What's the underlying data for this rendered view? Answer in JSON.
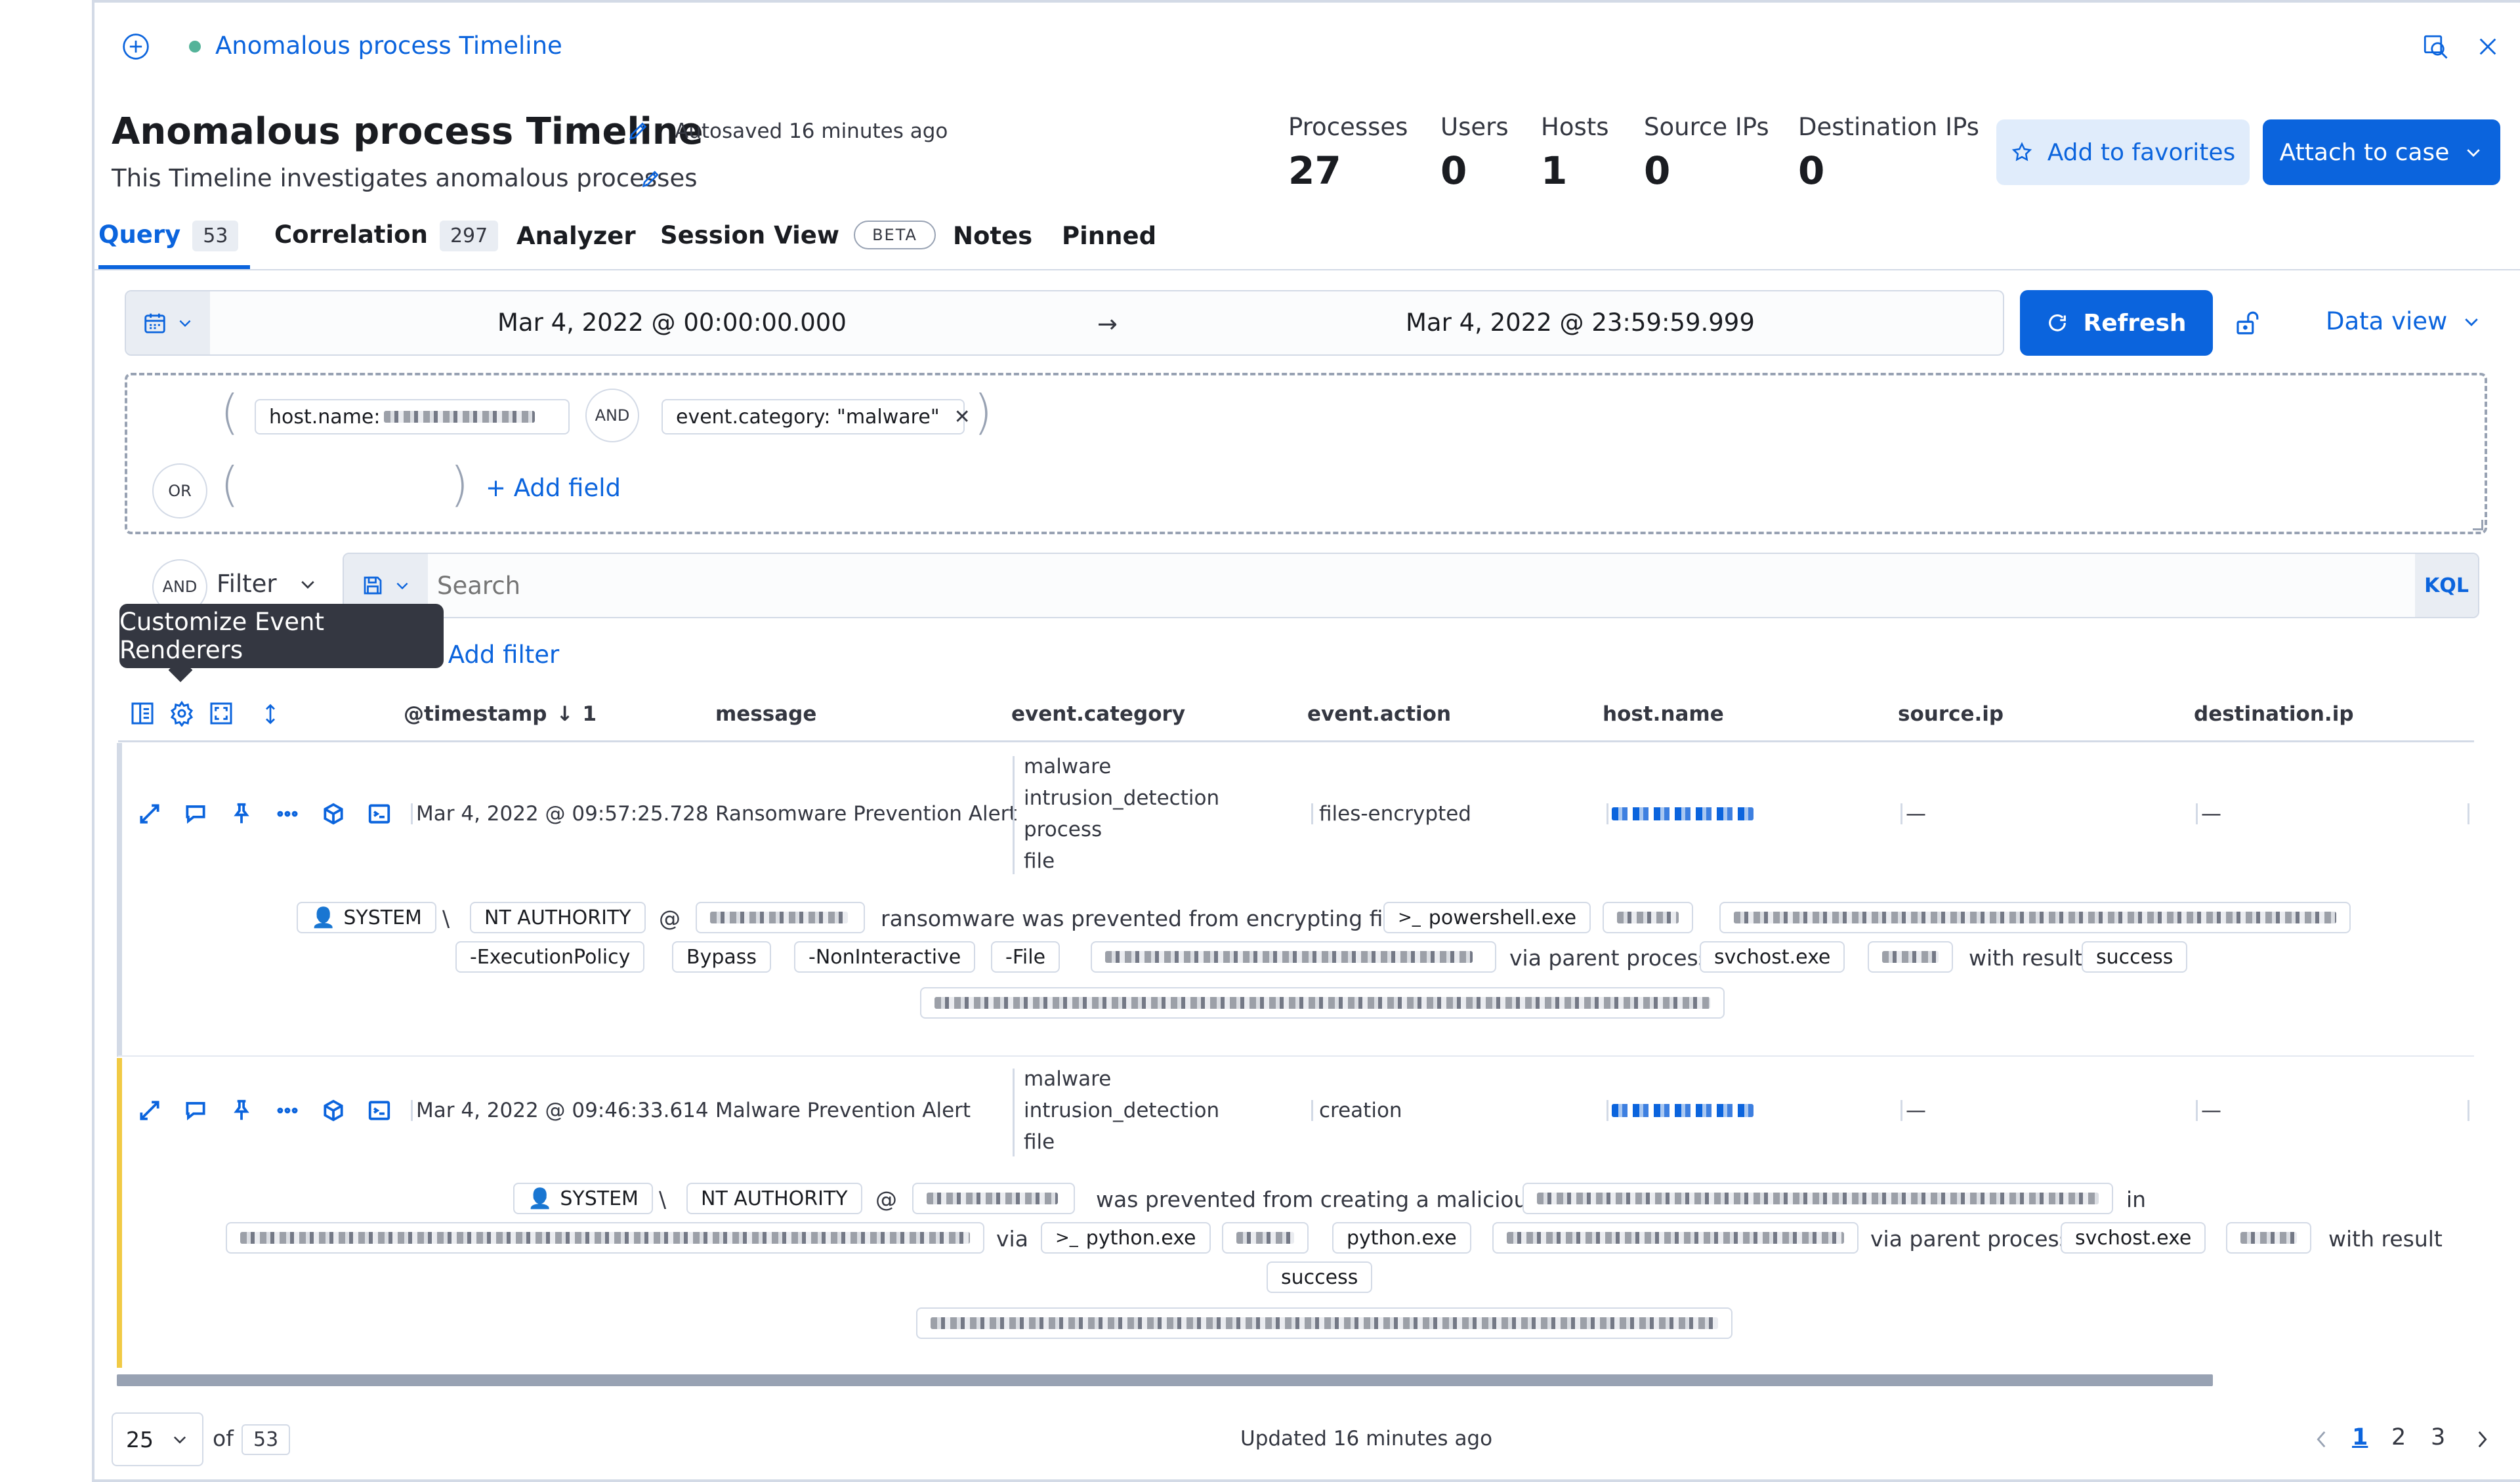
{
  "header": {
    "breadcrumb_title": "Anomalous process Timeline",
    "title": "Anomalous process Timeline",
    "autosaved": "Autosaved 16 minutes ago",
    "description": "This Timeline investigates anomalous processes"
  },
  "stats": [
    {
      "label": "Processes",
      "value": "27"
    },
    {
      "label": "Users",
      "value": "0"
    },
    {
      "label": "Hosts",
      "value": "1"
    },
    {
      "label": "Source IPs",
      "value": "0"
    },
    {
      "label": "Destination IPs",
      "value": "0"
    }
  ],
  "actions": {
    "favorites": "Add to favorites",
    "attach": "Attach to case"
  },
  "tabs": [
    {
      "label": "Query",
      "badge": "53"
    },
    {
      "label": "Correlation",
      "badge": "297"
    },
    {
      "label": "Analyzer"
    },
    {
      "label": "Session View",
      "badge": "BETA"
    },
    {
      "label": "Notes"
    },
    {
      "label": "Pinned"
    }
  ],
  "date_range": {
    "start": "Mar 4, 2022 @ 00:00:00.000",
    "arrow": "→",
    "end": "Mar 4, 2022 @ 23:59:59.999",
    "refresh": "Refresh",
    "data_view": "Data view"
  },
  "query_builder": {
    "open_paren": "(",
    "close_paren": ")",
    "host_field": "host.name: ",
    "and": "AND",
    "event_category": "event.category: \"malware\"",
    "or": "OR",
    "add_field": "+ Add field"
  },
  "filter_bar": {
    "and": "AND",
    "filter": "Filter",
    "search_placeholder": "Search",
    "kql": "KQL",
    "add_filter": "+ Add filter",
    "tooltip": "Customize Event Renderers"
  },
  "columns": {
    "timestamp": "@timestamp",
    "sort_index": "1",
    "message": "message",
    "category": "event.category",
    "action": "event.action",
    "host": "host.name",
    "source_ip": "source.ip",
    "destination_ip": "destination.ip"
  },
  "rows": [
    {
      "timestamp": "Mar 4, 2022 @ 09:57:25.728",
      "message": "Ransomware Prevention Alert",
      "categories": [
        "malware",
        "intrusion_detection",
        "process",
        "file"
      ],
      "action": "files-encrypted",
      "source_ip": "—",
      "destination_ip": "—",
      "renderer": {
        "user": "SYSTEM",
        "backslash": "\\",
        "domain": "NT AUTHORITY",
        "at": "@",
        "phrase": "ransomware was prevented from encrypting files via",
        "process": "powershell.exe",
        "arg1": "-ExecutionPolicy",
        "arg2": "Bypass",
        "arg3": "-NonInteractive",
        "arg4": "-File",
        "via_parent": "via parent process",
        "parent": "svchost.exe",
        "with_result": "with result",
        "result": "success"
      }
    },
    {
      "timestamp": "Mar 4, 2022 @ 09:46:33.614",
      "message": "Malware Prevention Alert",
      "categories": [
        "malware",
        "intrusion_detection",
        "file"
      ],
      "action": "creation",
      "source_ip": "—",
      "destination_ip": "—",
      "renderer": {
        "user": "SYSTEM",
        "backslash": "\\",
        "domain": "NT AUTHORITY",
        "at": "@",
        "phrase": "was prevented from creating a malicious file",
        "in": "in",
        "via": "via",
        "process": "python.exe",
        "process2": "python.exe",
        "via_parent": "via parent process",
        "parent": "svchost.exe",
        "with_result": "with result",
        "result": "success"
      }
    }
  ],
  "footer": {
    "page_size": "25",
    "of": "of",
    "total": "53",
    "updated": "Updated 16 minutes ago",
    "pages": [
      "1",
      "2",
      "3"
    ]
  },
  "colors": {
    "accent": "#0b64dd",
    "warning_bar": "#f1ca45",
    "row_bar": "#d3dae6"
  }
}
